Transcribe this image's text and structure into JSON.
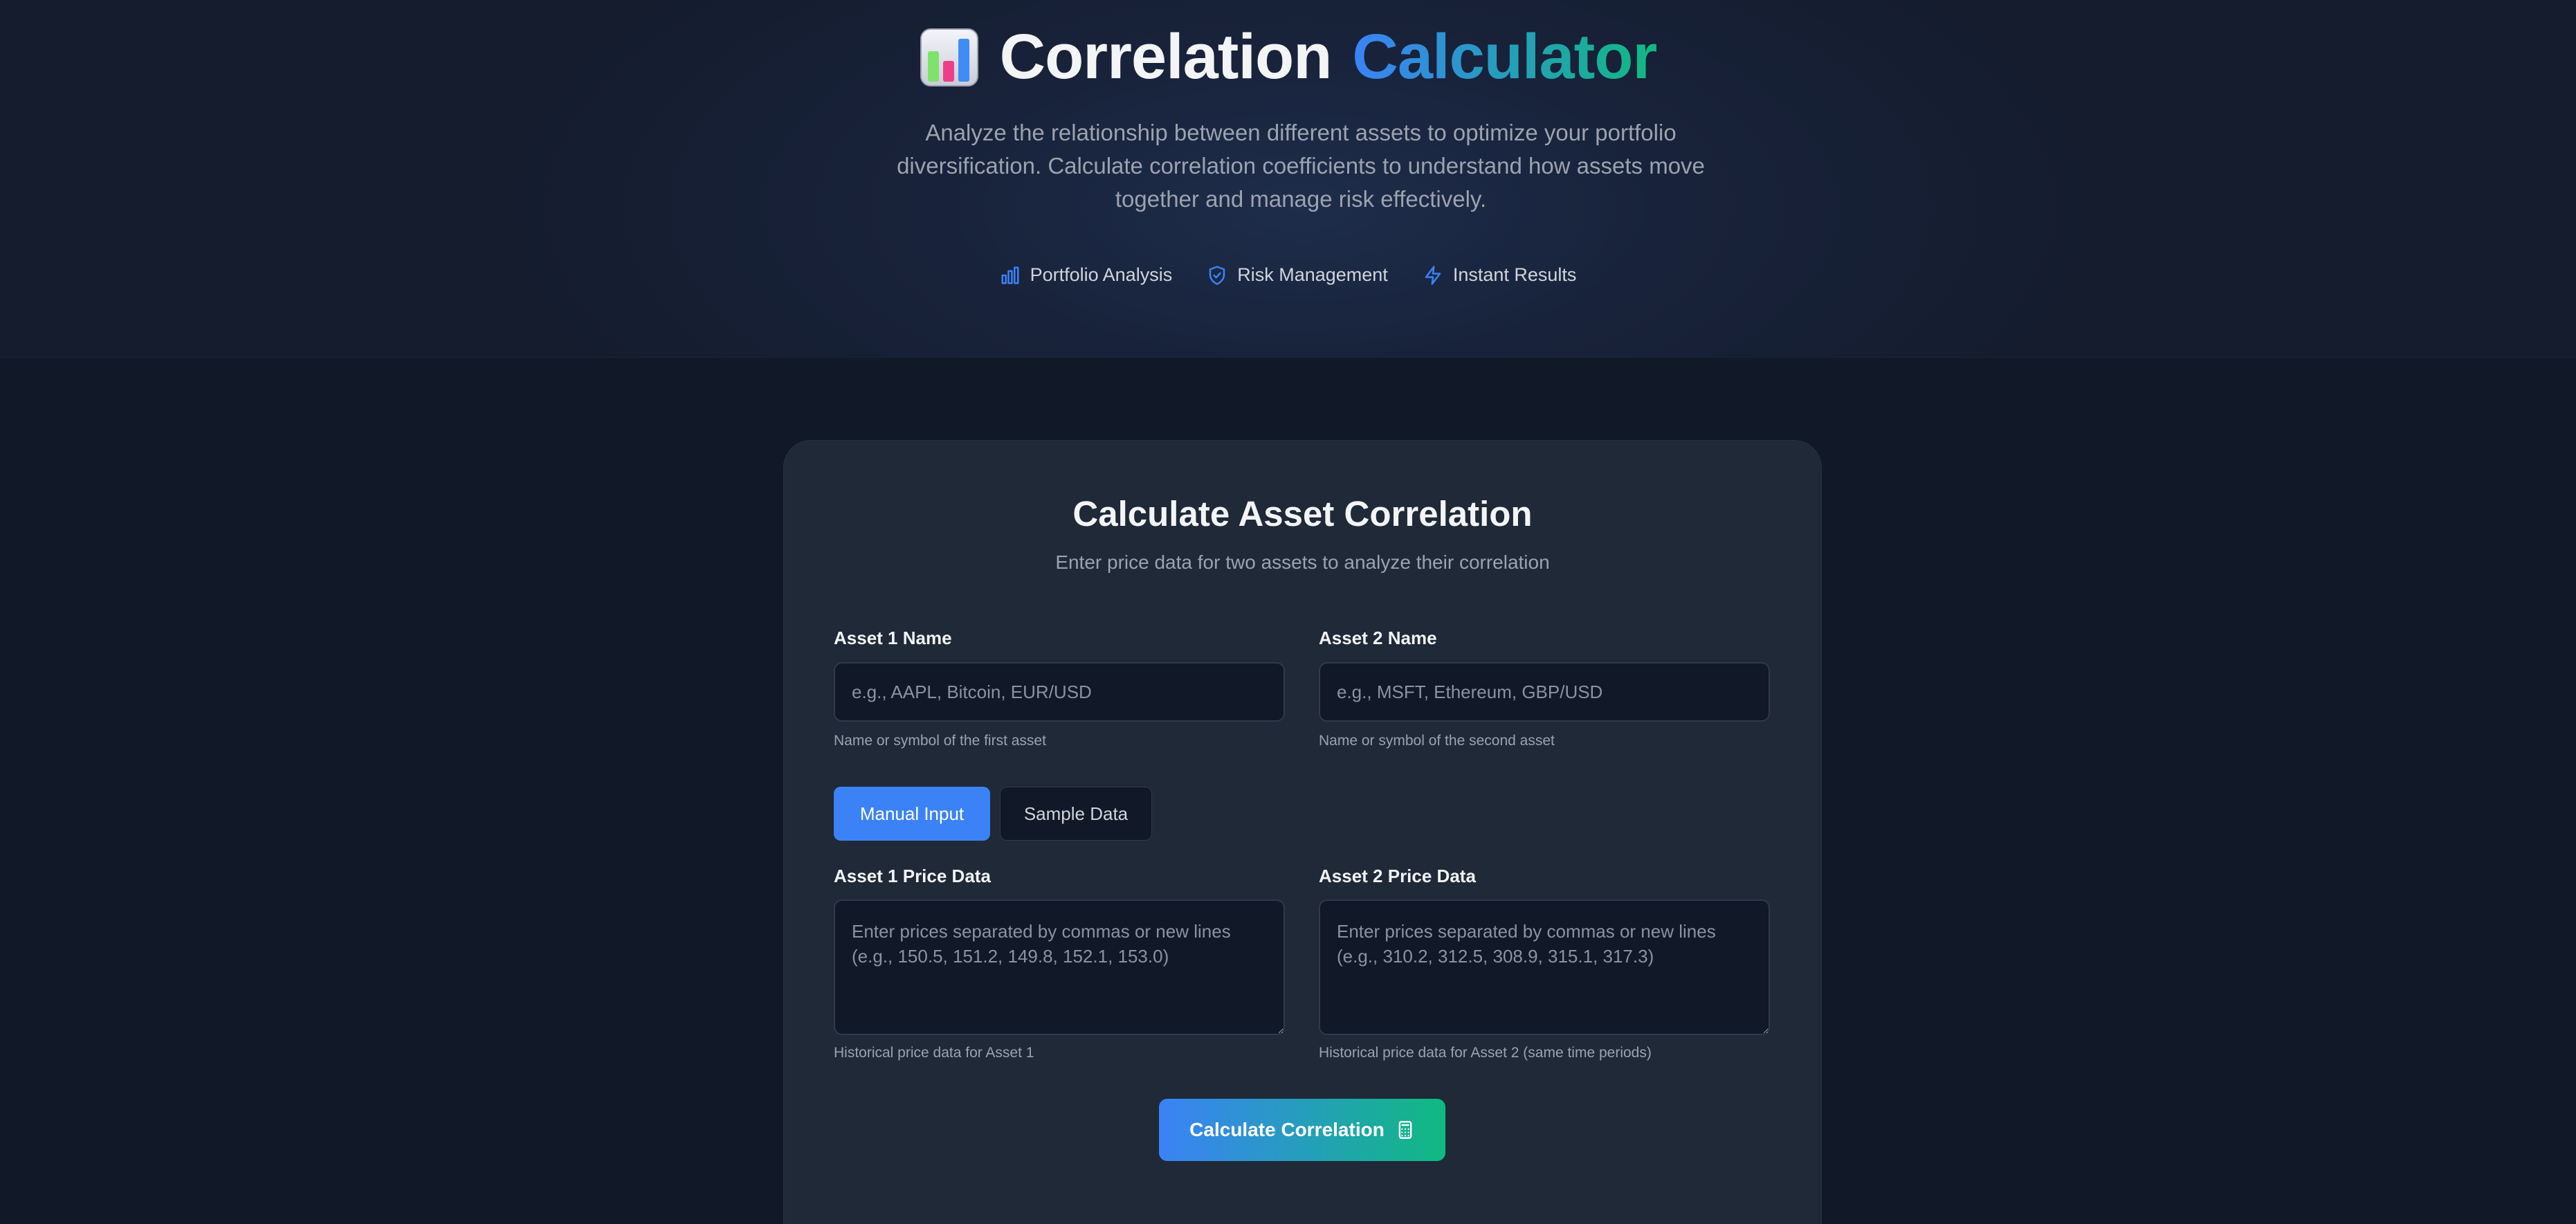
{
  "header": {
    "title_main": "Correlation",
    "title_accent": "Calculator",
    "logo_icon": "bar-chart-emoji-icon",
    "subtitle": "Analyze the relationship between different assets to optimize your portfolio diversification. Calculate correlation coefficients to understand how assets move together and manage risk effectively.",
    "features": [
      {
        "icon": "bar-chart-icon",
        "label": "Portfolio Analysis"
      },
      {
        "icon": "shield-check-icon",
        "label": "Risk Management"
      },
      {
        "icon": "lightning-icon",
        "label": "Instant Results"
      }
    ],
    "colors": {
      "accent_blue": "#3b82f6",
      "accent_green": "#10b981"
    }
  },
  "form": {
    "title": "Calculate Asset Correlation",
    "subtitle": "Enter price data for two assets to analyze their correlation",
    "asset1": {
      "label": "Asset 1 Name",
      "placeholder": "e.g., AAPL, Bitcoin, EUR/USD",
      "value": "",
      "hint": "Name or symbol of the first asset"
    },
    "asset2": {
      "label": "Asset 2 Name",
      "placeholder": "e.g., MSFT, Ethereum, GBP/USD",
      "value": "",
      "hint": "Name or symbol of the second asset"
    },
    "modes": {
      "manual": "Manual Input",
      "sample": "Sample Data",
      "active": "Manual Input"
    },
    "prices1": {
      "label": "Asset 1 Price Data",
      "placeholder": "Enter prices separated by commas or new lines\n(e.g., 150.5, 151.2, 149.8, 152.1, 153.0)",
      "hint": "Historical price data for Asset 1"
    },
    "prices2": {
      "label": "Asset 2 Price Data",
      "placeholder": "Enter prices separated by commas or new lines\n(e.g., 310.2, 312.5, 308.9, 315.1, 317.3)",
      "hint": "Historical price data for Asset 2 (same time periods)"
    },
    "submit": {
      "label": "Calculate Correlation",
      "icon": "calculator-icon"
    }
  }
}
